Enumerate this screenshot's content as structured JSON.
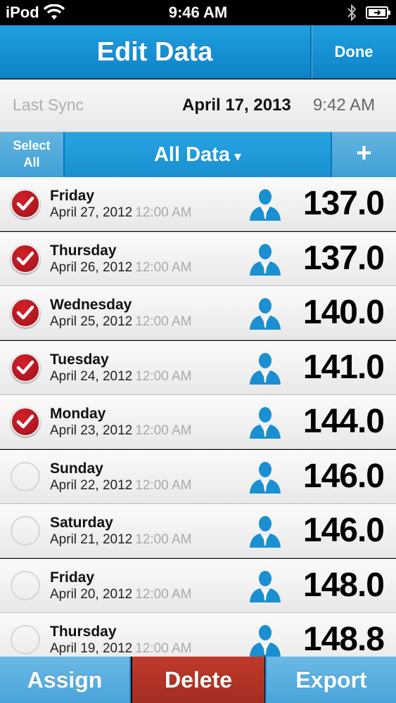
{
  "status_bar": {
    "carrier": "iPod",
    "time": "9:46 AM"
  },
  "header": {
    "title": "Edit Data",
    "done_label": "Done"
  },
  "sync": {
    "label": "Last Sync",
    "date": "April 17, 2013",
    "time": "9:42 AM"
  },
  "filter": {
    "select_all_line1": "Select",
    "select_all_line2": "All",
    "filter_label": "All Data",
    "caret": "▾",
    "add_label": "+"
  },
  "rows": [
    {
      "day": "Friday",
      "date": "April 27, 2012",
      "time": "12:00 AM",
      "value": "137.0",
      "checked": true
    },
    {
      "day": "Thursday",
      "date": "April 26, 2012",
      "time": "12:00 AM",
      "value": "137.0",
      "checked": true
    },
    {
      "day": "Wednesday",
      "date": "April 25, 2012",
      "time": "12:00 AM",
      "value": "140.0",
      "checked": true
    },
    {
      "day": "Tuesday",
      "date": "April 24, 2012",
      "time": "12:00 AM",
      "value": "141.0",
      "checked": true
    },
    {
      "day": "Monday",
      "date": "April 23, 2012",
      "time": "12:00 AM",
      "value": "144.0",
      "checked": true
    },
    {
      "day": "Sunday",
      "date": "April 22, 2012",
      "time": "12:00 AM",
      "value": "146.0",
      "checked": false
    },
    {
      "day": "Saturday",
      "date": "April 21, 2012",
      "time": "12:00 AM",
      "value": "146.0",
      "checked": false
    },
    {
      "day": "Friday",
      "date": "April 20, 2012",
      "time": "12:00 AM",
      "value": "148.0",
      "checked": false
    },
    {
      "day": "Thursday",
      "date": "April 19, 2012",
      "time": "12:00 AM",
      "value": "148.8",
      "checked": false
    }
  ],
  "toolbar": {
    "assign_label": "Assign",
    "delete_label": "Delete",
    "export_label": "Export"
  },
  "colors": {
    "accent": "#1a8fd1",
    "delete": "#b03226",
    "check": "#c0151f",
    "person_icon": "#1a8fd1"
  },
  "icons": {
    "wifi": "wifi-icon",
    "bluetooth": "bluetooth-icon",
    "battery": "battery-icon",
    "check": "checkmark-icon",
    "person": "person-icon"
  }
}
